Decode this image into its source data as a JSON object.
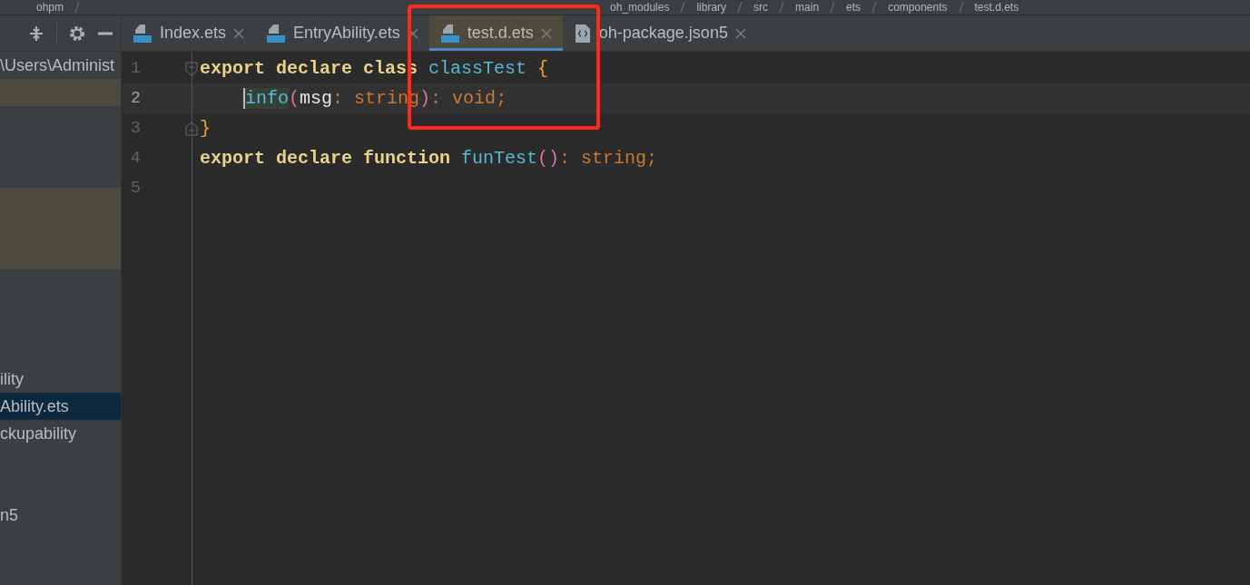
{
  "breadcrumbs": [
    "ohpm",
    "oh_modules",
    "library",
    "src",
    "main",
    "ets",
    "components",
    "test.d.ets"
  ],
  "sidebar": {
    "path": "\\Users\\Administ",
    "items": [
      {
        "label": "ility",
        "selected": false
      },
      {
        "label": "Ability.ets",
        "selected": true
      },
      {
        "label": "ckupability",
        "selected": false
      },
      {
        "label": "n5",
        "selected": false
      }
    ]
  },
  "tabs": [
    {
      "label": "Index.ets",
      "kind": "ets",
      "selected": false
    },
    {
      "label": "EntryAbility.ets",
      "kind": "ets",
      "selected": false
    },
    {
      "label": "test.d.ets",
      "kind": "ets",
      "selected": true
    },
    {
      "label": "oh-package.json5",
      "kind": "json",
      "selected": false
    }
  ],
  "editor": {
    "lines": [
      {
        "number": "1",
        "current": false,
        "fold_start": true,
        "fold_end": false,
        "indented": false,
        "tokens": [
          {
            "kind": "keyword",
            "text": "export declare class "
          },
          {
            "kind": "class",
            "text": "classTest "
          },
          {
            "kind": "brace",
            "text": "{"
          }
        ]
      },
      {
        "number": "2",
        "current": true,
        "fold_start": false,
        "fold_end": false,
        "indented": true,
        "tokens": [
          {
            "kind": "method",
            "text": "info"
          },
          {
            "kind": "paren",
            "text": "("
          },
          {
            "kind": "plain",
            "text": "msg"
          },
          {
            "kind": "punct",
            "text": ": "
          },
          {
            "kind": "type",
            "text": "string"
          },
          {
            "kind": "paren",
            "text": ")"
          },
          {
            "kind": "punct",
            "text": ": "
          },
          {
            "kind": "type",
            "text": "void"
          },
          {
            "kind": "punct",
            "text": ";"
          }
        ]
      },
      {
        "number": "3",
        "current": false,
        "fold_start": false,
        "fold_end": true,
        "indented": false,
        "tokens": [
          {
            "kind": "brace",
            "text": "}"
          }
        ]
      },
      {
        "number": "4",
        "current": false,
        "fold_start": false,
        "fold_end": false,
        "indented": false,
        "tokens": [
          {
            "kind": "keyword",
            "text": "export declare function "
          },
          {
            "kind": "class",
            "text": "funTest"
          },
          {
            "kind": "paren",
            "text": "()"
          },
          {
            "kind": "punct",
            "text": ": "
          },
          {
            "kind": "type",
            "text": "string"
          },
          {
            "kind": "punct",
            "text": ";"
          }
        ]
      },
      {
        "number": "5",
        "current": false,
        "fold_start": false,
        "fold_end": false,
        "indented": false
      }
    ]
  }
}
